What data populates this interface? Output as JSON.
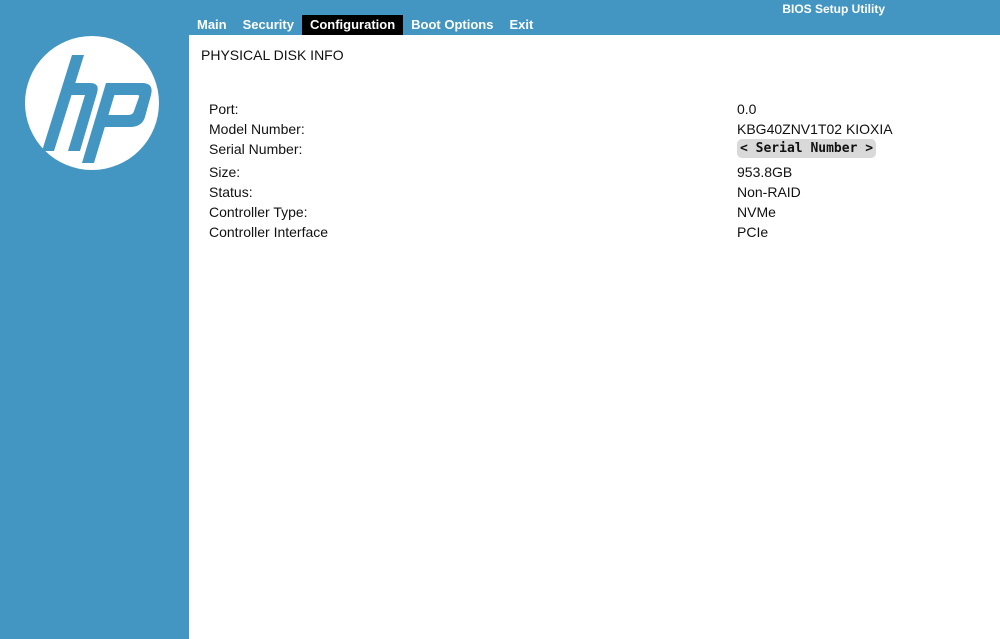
{
  "app": {
    "title": "BIOS Setup Utility"
  },
  "brand": {
    "logo": "hp-logo",
    "logo_text": "hp",
    "sidebar_color": "#4296c1"
  },
  "menu": {
    "items": [
      {
        "label": "Main",
        "active": false
      },
      {
        "label": "Security",
        "active": false
      },
      {
        "label": "Configuration",
        "active": true
      },
      {
        "label": "Boot Options",
        "active": false
      },
      {
        "label": "Exit",
        "active": false
      }
    ]
  },
  "page": {
    "title": "PHYSICAL DISK INFO"
  },
  "disk_info": {
    "rows": [
      {
        "label": "Port:",
        "value": "0.0"
      },
      {
        "label": "Model Number:",
        "value": "KBG40ZNV1T02 KIOXIA"
      },
      {
        "label": "Serial Number:",
        "value": "< Serial Number >"
      },
      {
        "label": "Size:",
        "value": "953.8GB"
      },
      {
        "label": "Status:",
        "value": "Non-RAID"
      },
      {
        "label": "Controller Type:",
        "value": "NVMe"
      },
      {
        "label": "Controller Interface",
        "value": "PCIe"
      }
    ]
  }
}
